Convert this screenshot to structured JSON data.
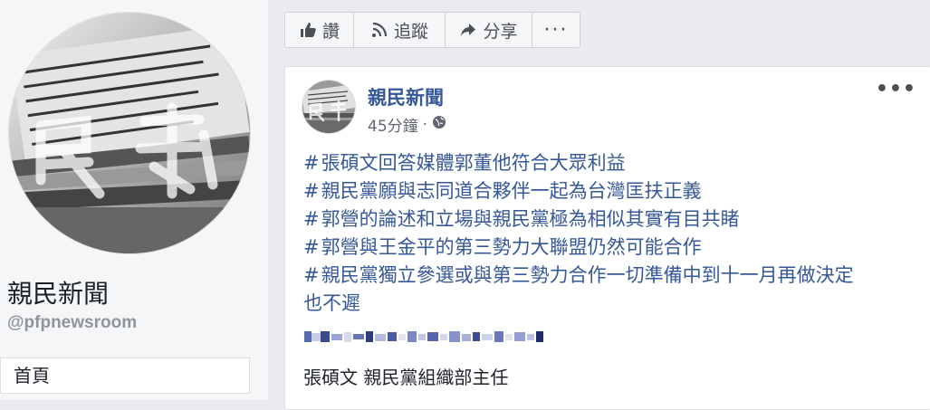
{
  "page": {
    "name": "親民新聞",
    "handle": "@pfpnewsroom",
    "nav_home": "首頁"
  },
  "actions": {
    "like_label": "讚",
    "follow_label": "追蹤",
    "share_label": "分享",
    "more_label": "···"
  },
  "post": {
    "author": "親民新聞",
    "time": "45分鐘",
    "separator": "·",
    "options_label": "•••",
    "hashtags": [
      "張碩文回答媒體郭董他符合大眾利益",
      "親民黨願與志同道合夥伴一起為台灣匡扶正義",
      "郭營的論述和立場與親民黨極為相似其實有目共睹",
      "郭營與王金平的第三勢力大聯盟仍然可能合作",
      "親民黨獨立參選或與第三勢力合作一切準備中到十一月再做決定"
    ],
    "hashtag_tail": "也不遲",
    "caption": "張碩文 親民黨組織部主任"
  },
  "colors": {
    "link": "#365899",
    "text": "#1d2129",
    "muted": "#616770",
    "background": "#e9ebee"
  }
}
